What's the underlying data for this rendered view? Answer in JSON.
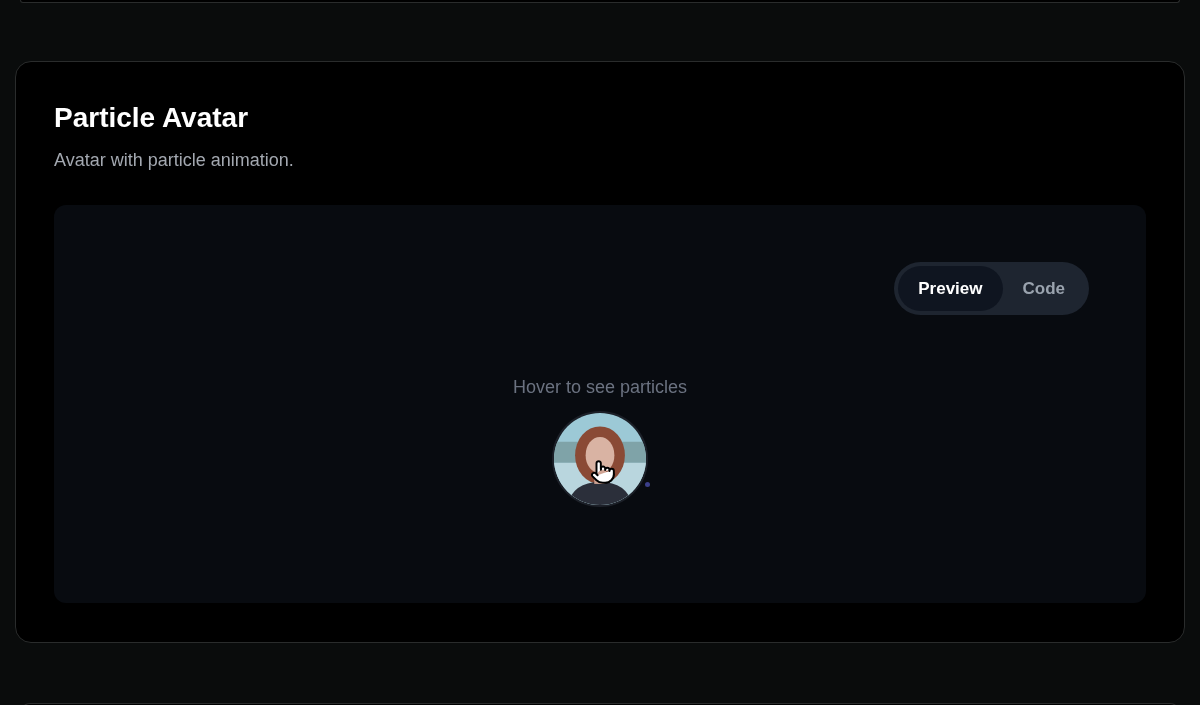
{
  "section": {
    "title": "Particle Avatar",
    "description": "Avatar with particle animation."
  },
  "tabs": [
    {
      "label": "Preview",
      "selected": true
    },
    {
      "label": "Code",
      "selected": false
    }
  ],
  "preview": {
    "hint": "Hover to see particles"
  }
}
